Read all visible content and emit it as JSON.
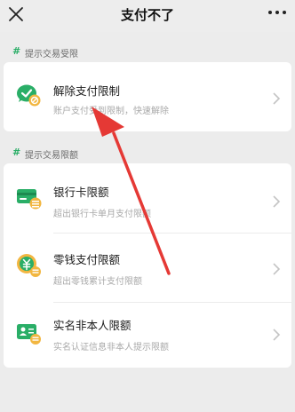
{
  "header": {
    "title": "支付不了"
  },
  "icons": {
    "close": "close-icon",
    "more": "more-dots-icon",
    "chevron": "chevron-right-icon"
  },
  "colors": {
    "accent": "#2aae67",
    "gold": "#f2b640",
    "annotation": "#e53935"
  },
  "section1": {
    "label": "提示交易受限",
    "items": [
      {
        "title": "解除支付限制",
        "subtitle": "账户支付受到限制，快速解除",
        "icon": "payment-restriction-icon"
      }
    ]
  },
  "section2": {
    "label": "提示交易限额",
    "items": [
      {
        "title": "银行卡限额",
        "subtitle": "超出银行卡单月支付限额",
        "icon": "bank-card-icon"
      },
      {
        "title": "零钱支付限额",
        "subtitle": "超出零钱累计支付限额",
        "icon": "wallet-change-icon"
      },
      {
        "title": "实名非本人限额",
        "subtitle": "实名认证信息非本人提示限额",
        "icon": "id-card-icon"
      }
    ]
  }
}
